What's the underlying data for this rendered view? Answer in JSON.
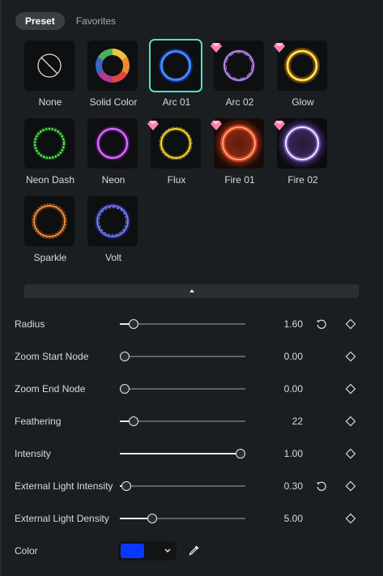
{
  "tabs": [
    {
      "label": "Preset",
      "active": true
    },
    {
      "label": "Favorites",
      "active": false
    }
  ],
  "presets": [
    {
      "label": "None",
      "icon": "none-slash-icon",
      "premium": false,
      "selected": false
    },
    {
      "label": "Solid Color",
      "icon": "color-wheel-icon",
      "premium": false,
      "selected": false
    },
    {
      "label": "Arc 01",
      "icon": "blue-arc-ring-icon",
      "premium": false,
      "selected": true,
      "color": "#1e6bff"
    },
    {
      "label": "Arc 02",
      "icon": "purple-arc-ring-icon",
      "premium": true,
      "selected": false,
      "color": "#c58cff"
    },
    {
      "label": "Glow",
      "icon": "gold-glow-ring-icon",
      "premium": true,
      "selected": false,
      "color": "#ffcc1a"
    },
    {
      "label": "Neon Dash",
      "icon": "green-dashed-ring-icon",
      "premium": false,
      "selected": false,
      "color": "#4ee34a"
    },
    {
      "label": "Neon",
      "icon": "magenta-neon-ring-icon",
      "premium": false,
      "selected": false,
      "color": "#d64bff"
    },
    {
      "label": "Flux",
      "icon": "yellow-flux-ring-icon",
      "premium": true,
      "selected": false,
      "color": "#ffdd33"
    },
    {
      "label": "Fire 01",
      "icon": "fire-ring-icon",
      "premium": true,
      "selected": false,
      "color": "#ff7a45"
    },
    {
      "label": "Fire 02",
      "icon": "violet-fire-ring-icon",
      "premium": true,
      "selected": false,
      "color": "#e6d2ff"
    },
    {
      "label": "Sparkle",
      "icon": "orange-sparkle-ring-icon",
      "premium": false,
      "selected": false,
      "color": "#ff9a3c"
    },
    {
      "label": "Volt",
      "icon": "blue-volt-ring-icon",
      "premium": false,
      "selected": false,
      "color": "#5b6bff"
    }
  ],
  "params": [
    {
      "id": "radius",
      "label": "Radius",
      "value": "1.60",
      "fraction": 0.11,
      "has_reset": true
    },
    {
      "id": "zoom-start-node",
      "label": "Zoom Start Node",
      "value": "0.00",
      "fraction": 0.04,
      "has_reset": false
    },
    {
      "id": "zoom-end-node",
      "label": "Zoom End Node",
      "value": "0.00",
      "fraction": 0.04,
      "has_reset": false
    },
    {
      "id": "feathering",
      "label": "Feathering",
      "value": "22",
      "fraction": 0.11,
      "has_reset": false
    },
    {
      "id": "intensity",
      "label": "Intensity",
      "value": "1.00",
      "fraction": 0.96,
      "has_reset": false
    },
    {
      "id": "external-light-intensity",
      "label": "External Light Intensity",
      "value": "0.30",
      "fraction": 0.05,
      "has_reset": true
    },
    {
      "id": "external-light-density",
      "label": "External Light Density",
      "value": "5.00",
      "fraction": 0.26,
      "has_reset": false
    }
  ],
  "color": {
    "label": "Color",
    "value": "#0a37ff"
  },
  "colors": {
    "accent_selected": "#4fe3c1",
    "background": "#1b1e21",
    "premium_gem": "#ff7fb0"
  }
}
